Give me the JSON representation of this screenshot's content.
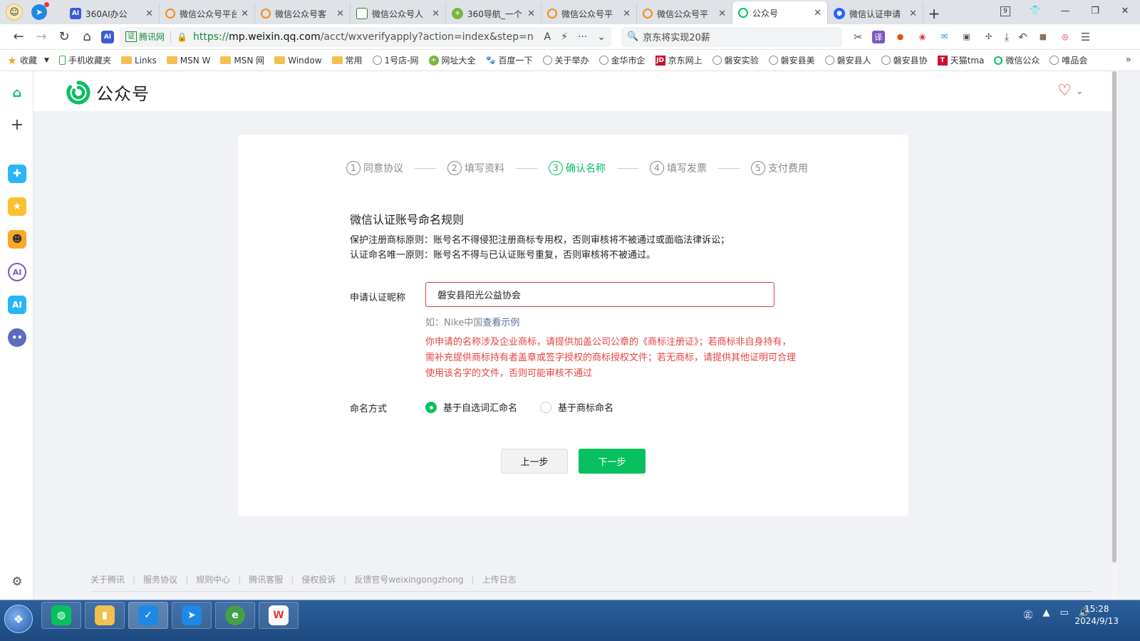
{
  "browser": {
    "tabs": [
      {
        "title": "360AI办公",
        "icon": "ai-icon",
        "active": false
      },
      {
        "title": "微信公众号平台",
        "icon": "wechat-search-icon",
        "active": false
      },
      {
        "title": "微信公众号客",
        "icon": "wechat-search-icon",
        "active": false
      },
      {
        "title": "微信公众号人",
        "icon": "doc-icon",
        "active": false
      },
      {
        "title": "360导航_一个",
        "icon": "nav-icon",
        "active": false
      },
      {
        "title": "微信公众号平",
        "icon": "wechat-search-icon",
        "active": false
      },
      {
        "title": "微信公众号平",
        "icon": "wechat-search-icon",
        "active": false
      },
      {
        "title": "公众号",
        "icon": "gzh-icon",
        "active": true
      },
      {
        "title": "微信认证申请",
        "icon": "cert-icon",
        "active": false
      }
    ],
    "tab_count_badge": "9",
    "address": {
      "cert_label": "腾讯网",
      "url_scheme": "https://",
      "url_host": "mp.weixin.qq.com",
      "url_path": "/acct/wxverifyapply?action=index&step=n"
    },
    "search_text": "京东将实现20薪",
    "bookmarks": [
      {
        "label": "收藏",
        "icon": "star-icon"
      },
      {
        "label": "手机收藏夹",
        "icon": "phone-icon"
      },
      {
        "label": "Links",
        "icon": "folder-icon"
      },
      {
        "label": "MSN W",
        "icon": "folder-icon"
      },
      {
        "label": "MSN 网",
        "icon": "folder-icon"
      },
      {
        "label": "Window",
        "icon": "folder-icon"
      },
      {
        "label": "常用",
        "icon": "folder-icon"
      },
      {
        "label": "1号店-网",
        "icon": "globe-icon"
      },
      {
        "label": "网址大全",
        "icon": "nav-icon"
      },
      {
        "label": "百度一下",
        "icon": "baidu-icon"
      },
      {
        "label": "关于举办",
        "icon": "globe-icon"
      },
      {
        "label": "金华市企",
        "icon": "globe-icon"
      },
      {
        "label": "京东网上",
        "icon": "jd-icon"
      },
      {
        "label": "磐安实验",
        "icon": "globe-icon"
      },
      {
        "label": "磐安县美",
        "icon": "globe-icon"
      },
      {
        "label": "磐安县人",
        "icon": "globe-icon"
      },
      {
        "label": "磐安县协",
        "icon": "globe-icon"
      },
      {
        "label": "天猫tma",
        "icon": "tmall-icon"
      },
      {
        "label": "微信公众",
        "icon": "gzh-icon"
      },
      {
        "label": "唯品会",
        "icon": "globe-icon"
      }
    ]
  },
  "page": {
    "logo_text": "公众号",
    "steps": [
      {
        "num": "1",
        "label": "同意协议",
        "active": false
      },
      {
        "num": "2",
        "label": "填写资料",
        "active": false
      },
      {
        "num": "3",
        "label": "确认名称",
        "active": true
      },
      {
        "num": "4",
        "label": "填写发票",
        "active": false
      },
      {
        "num": "5",
        "label": "支付费用",
        "active": false
      }
    ],
    "rules_title": "微信认证账号命名规则",
    "rule_1": "保护注册商标原则：账号名不得侵犯注册商标专用权，否则审核将不被通过或面临法律诉讼；",
    "rule_2": "认证命名唯一原则：账号名不得与已认证账号重复，否则审核将不被通过。",
    "name_label": "申请认证昵称",
    "name_value": "磐安县阳光公益协会",
    "hint_prefix": "如：Nike中国",
    "hint_link": "查看示例",
    "warning": "你申请的名称涉及企业商标，请提供加盖公司公章的《商标注册证》；若商标非自身持有，需补充提供商标持有者盖章或签字授权的商标授权文件；若无商标，请提供其他证明可合理使用该名字的文件，否则可能审核不通过",
    "naming_label": "命名方式",
    "naming_options": [
      {
        "label": "基于自选词汇命名",
        "selected": true
      },
      {
        "label": "基于商标命名",
        "selected": false
      }
    ],
    "prev_button": "上一步",
    "next_button": "下一步",
    "footer_links": [
      "关于腾讯",
      "服务协议",
      "规则中心",
      "腾讯客服",
      "侵权投诉",
      "反馈官号weixingongzhong",
      "上传日志"
    ]
  },
  "taskbar": {
    "time": "15:28",
    "date": "2024/9/13"
  },
  "colors": {
    "brand_green": "#07c160",
    "error_red": "#e64340",
    "link_blue": "#576b95"
  }
}
